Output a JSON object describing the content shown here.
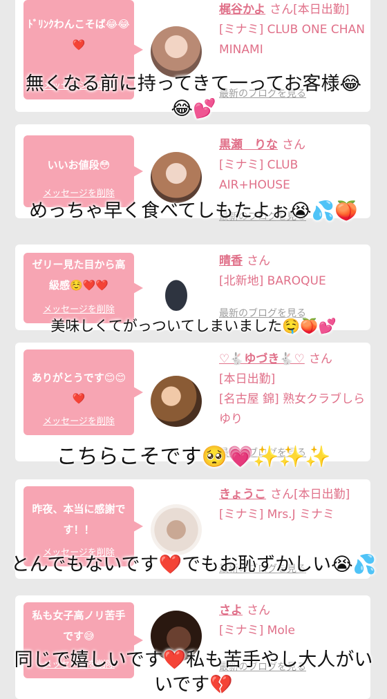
{
  "cards": [
    {
      "message": "ﾄﾞﾘﾝｸわんこそば😂😂❤️",
      "delete_label": "メッセージを削除",
      "name": "梶谷かよ",
      "honorific": "さん",
      "status": "[本日出勤]",
      "shop": "[ミナミ] CLUB ONE CHAN MINAMI",
      "blog_label": "最新のブログを見る"
    },
    {
      "message": "いいお値段😳",
      "delete_label": "メッセージを削除",
      "name": "黒瀬　りな",
      "honorific": "さん",
      "status": "",
      "shop": "[ミナミ] CLUB AIR+HOUSE",
      "blog_label": "最新のブログを見る"
    },
    {
      "message": "ゼリー見た目から高級感☺️❤️❤️",
      "delete_label": "メッセージを削除",
      "name": "晴香",
      "honorific": "さん",
      "status": "",
      "shop": "[北新地] BAROQUE",
      "blog_label": "最新のブログを見る"
    },
    {
      "message": "ありがとうです😊😊❤️",
      "delete_label": "メッセージを削除",
      "name": "♡🐇ゆづき🐇♡",
      "honorific": "さん",
      "status": "[本日出勤]",
      "shop": "[名古屋 錦] 熟女クラブしらゆり",
      "blog_label": "最新のブログを見る"
    },
    {
      "message": "昨夜、本当に感謝です！！",
      "delete_label": "メッセージを削除",
      "name": "きょうこ",
      "honorific": "さん",
      "status": "[本日出勤]",
      "shop": "[ミナミ] Mrs.J ミナミ",
      "blog_label": "最新のブログを見る"
    },
    {
      "message": "私も女子高ノリ苦手です😅",
      "delete_label": "メッセージを削除",
      "name": "さよ",
      "honorific": "さん",
      "status": "",
      "shop": "[ミナミ] Mole",
      "blog_label": "最新のブログを見る"
    }
  ],
  "overlays": [
    "無くなる前に持ってきて一ってお客様😂😂💕",
    "めっちゃ早く食べてしもたよぉ😭💦🍑",
    "美味しくてがっついてしまいました🤤🍑💕",
    "こちらこそです🥺💗✨✨✨",
    "とんでもないです❤️でもお恥ずかしい😭💦",
    "同じで嬉しいです❤️私も苦手やし大人がいいです💔"
  ]
}
